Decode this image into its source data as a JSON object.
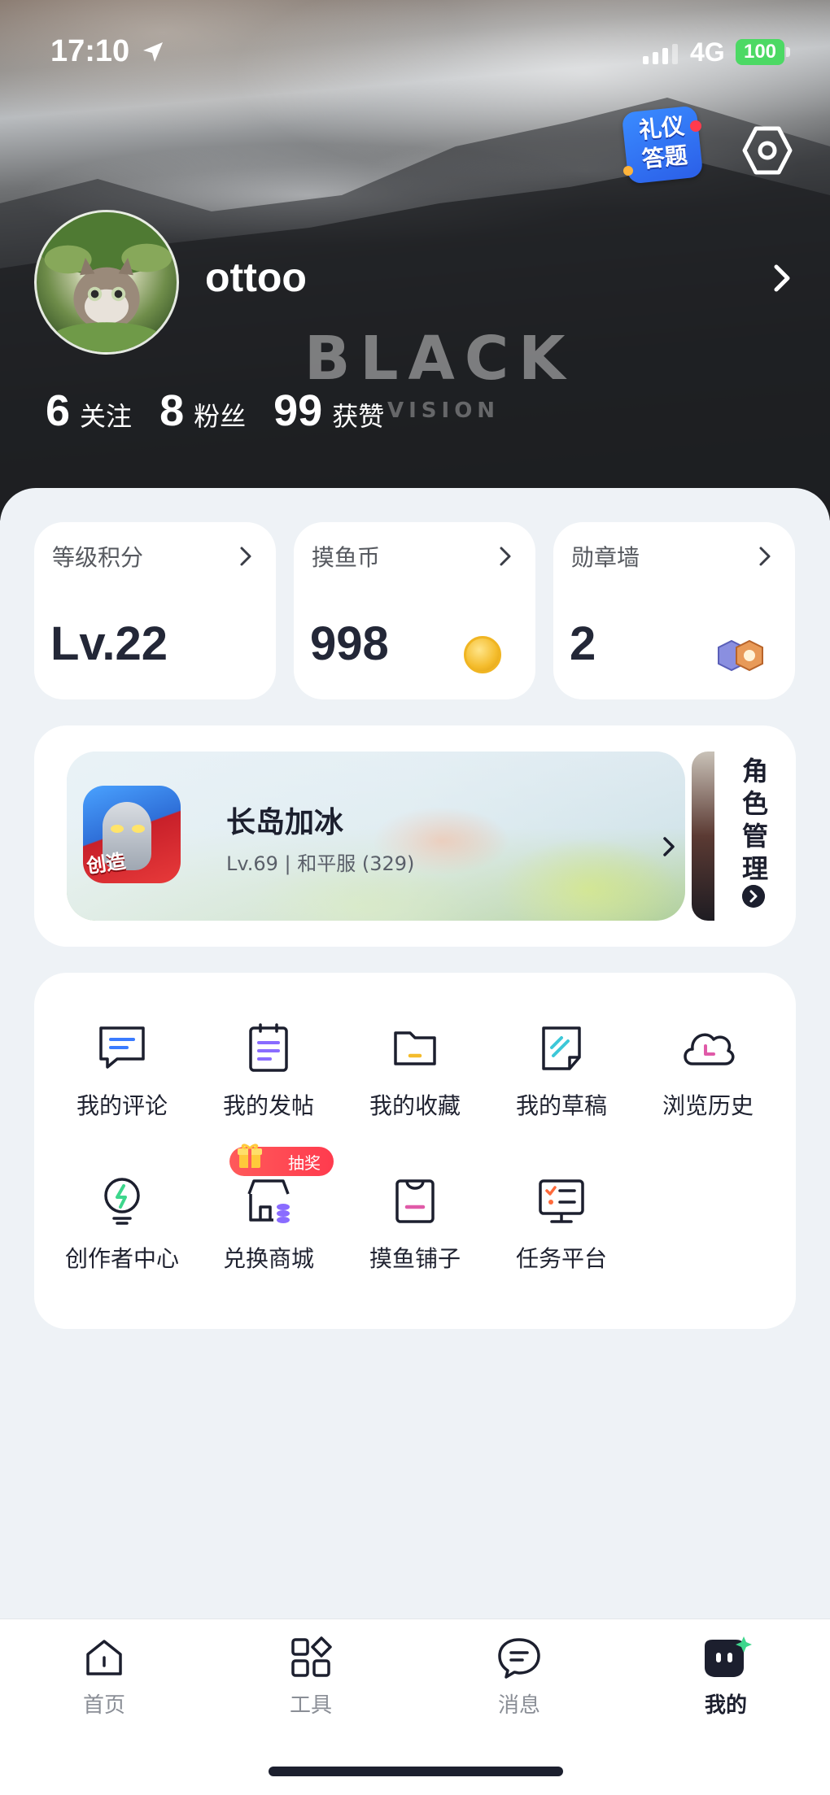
{
  "status_bar": {
    "time": "17:10",
    "network": "4G",
    "battery": "100"
  },
  "hero": {
    "overlay_title": "BLACK",
    "overlay_sub": "VISION"
  },
  "quiz_badge": {
    "line1": "礼仪",
    "line2": "答题"
  },
  "profile": {
    "username": "ottoo",
    "stats": [
      {
        "value": "6",
        "label": "关注"
      },
      {
        "value": "8",
        "label": "粉丝"
      },
      {
        "value": "99",
        "label": "获赞"
      }
    ]
  },
  "cards": [
    {
      "title": "等级积分",
      "value": "Lv.22"
    },
    {
      "title": "摸鱼币",
      "value": "998"
    },
    {
      "title": "勋章墙",
      "value": "2"
    }
  ],
  "game": {
    "icon_text": "创造",
    "name": "长岛加冰",
    "detail": "Lv.69 | 和平服 (329)",
    "role_label": [
      "角",
      "色",
      "管",
      "理"
    ]
  },
  "grid": {
    "items": [
      {
        "label": "我的评论",
        "icon": "comment-icon"
      },
      {
        "label": "我的发帖",
        "icon": "post-icon"
      },
      {
        "label": "我的收藏",
        "icon": "folder-icon"
      },
      {
        "label": "我的草稿",
        "icon": "draft-icon"
      },
      {
        "label": "浏览历史",
        "icon": "history-cloud-icon"
      },
      {
        "label": "创作者中心",
        "icon": "lightbulb-icon"
      },
      {
        "label": "兑换商城",
        "icon": "shop-icon"
      },
      {
        "label": "摸鱼铺子",
        "icon": "bag-icon"
      },
      {
        "label": "任务平台",
        "icon": "task-board-icon"
      }
    ],
    "lottery_tag": "抽奖"
  },
  "tabbar": {
    "tabs": [
      {
        "label": "首页",
        "icon": "home-icon"
      },
      {
        "label": "工具",
        "icon": "tools-grid-icon"
      },
      {
        "label": "消息",
        "icon": "message-icon"
      },
      {
        "label": "我的",
        "icon": "mine-icon",
        "active": true
      }
    ]
  },
  "colors": {
    "accent_blue": "#3a7bff",
    "accent_purple": "#8a6cff",
    "accent_pink": "#e05aa8",
    "accent_yellow": "#f4bc2c",
    "accent_green": "#3dd68c",
    "text_dark": "#1c1f2e"
  }
}
